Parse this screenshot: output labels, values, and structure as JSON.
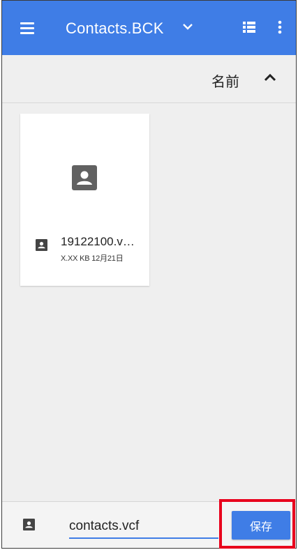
{
  "app_bar": {
    "title": "Contacts.BCK",
    "icons": [
      "menu-icon",
      "chevron-down-icon",
      "list-view-icon",
      "more-vert-icon"
    ]
  },
  "sort_bar": {
    "label": "名前",
    "direction_icon": "arrow-up-icon"
  },
  "files": [
    {
      "name": "19122100.v…",
      "meta": "X.XX KB 12月21日",
      "icon": "contact-card-icon"
    }
  ],
  "save_bar": {
    "icon": "contact-card-icon",
    "filename_value": "contacts.vcf",
    "save_label": "保存"
  },
  "colors": {
    "accent": "#3f7de6",
    "highlight": "#e8001c",
    "background": "#efefef"
  }
}
